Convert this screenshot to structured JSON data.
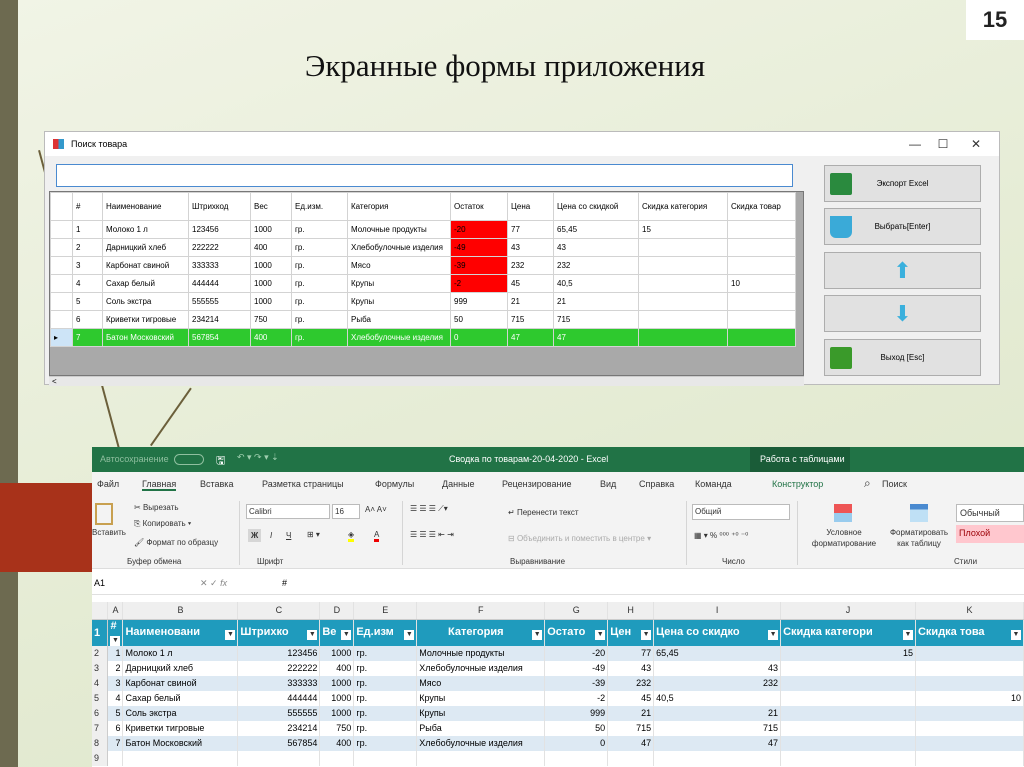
{
  "slide": {
    "number": "15",
    "title": "Экранные формы приложения"
  },
  "form": {
    "title": "Поиск товара",
    "search_value": "",
    "columns": [
      "#",
      "Наименование",
      "Штрихкод",
      "Вес",
      "Ед.изм.",
      "Категория",
      "Остаток",
      "Цена",
      "Цена со скидкой",
      "Скидка категория",
      "Скидка товар"
    ],
    "rows": [
      [
        "1",
        "Молоко 1 л",
        "123456",
        "1000",
        "гр.",
        "Молочные продукты",
        "-20",
        "77",
        "65,45",
        "15",
        ""
      ],
      [
        "2",
        "Дарницкий хлеб",
        "222222",
        "400",
        "гр.",
        "Хлебобулочные изделия",
        "-49",
        "43",
        "43",
        "",
        ""
      ],
      [
        "3",
        "Карбонат свиной",
        "333333",
        "1000",
        "гр.",
        "Мясо",
        "-39",
        "232",
        "232",
        "",
        ""
      ],
      [
        "4",
        "Сахар белый",
        "444444",
        "1000",
        "гр.",
        "Крупы",
        "-2",
        "45",
        "40,5",
        "",
        "10"
      ],
      [
        "5",
        "Соль экстра",
        "555555",
        "1000",
        "гр.",
        "Крупы",
        "999",
        "21",
        "21",
        "",
        ""
      ],
      [
        "6",
        "Криветки тигровые",
        "234214",
        "750",
        "гр.",
        "Рыба",
        "50",
        "715",
        "715",
        "",
        ""
      ],
      [
        "7",
        "Батон Московский",
        "567854",
        "400",
        "гр.",
        "Хлебобулочные изделия",
        "0",
        "47",
        "47",
        "",
        ""
      ]
    ],
    "selected_row": 7,
    "buttons": {
      "export": "Экспорт Excel",
      "select": "Выбрать[Enter]",
      "exit": "Выход [Esc]"
    }
  },
  "excel": {
    "autosave": "Автосохранение",
    "title": "Сводка по товарам-20-04-2020  -  Excel",
    "context_tab": "Работа с таблицами",
    "tabs": [
      "Файл",
      "Главная",
      "Вставка",
      "Разметка страницы",
      "Формулы",
      "Данные",
      "Рецензирование",
      "Вид",
      "Справка",
      "Команда",
      "Конструктор"
    ],
    "search": "Поиск",
    "ribbon": {
      "paste": "Вставить",
      "cut": "Вырезать",
      "copy": "Копировать",
      "format_painter": "Формат по образцу",
      "clipboard": "Буфер обмена",
      "font_name": "Calibri",
      "font_size": "16",
      "font": "Шрифт",
      "bold": "Ж",
      "italic": "I",
      "underline": "Ч",
      "wrap": "Перенести текст",
      "merge": "Объединить и поместить в центре",
      "alignment": "Выравнивание",
      "number_format": "Общий",
      "number": "Число",
      "cond_format": "Условное форматирование",
      "format_table": "Форматировать как таблицу",
      "styles": "Стили",
      "style_normal": "Обычный",
      "style_bad": "Плохой"
    },
    "name_box": "A1",
    "formula": "#",
    "col_letters": [
      "A",
      "B",
      "C",
      "D",
      "E",
      "F",
      "G",
      "H",
      "I",
      "J",
      "K"
    ],
    "headers": [
      "#",
      "Наименовани",
      "Штрихко",
      "Ве",
      "Ед.изм",
      "Категория",
      "Остато",
      "Цен",
      "Цена со скидко",
      "Скидка категори",
      "Скидка това"
    ],
    "rows": [
      [
        "1",
        "Молоко 1 л",
        "123456",
        "1000",
        "гр.",
        "Молочные продукты",
        "-20",
        "77",
        "65,45",
        "15",
        ""
      ],
      [
        "2",
        "Дарницкий хлеб",
        "222222",
        "400",
        "гр.",
        "Хлебобулочные изделия",
        "-49",
        "43",
        "43",
        "",
        ""
      ],
      [
        "3",
        "Карбонат свиной",
        "333333",
        "1000",
        "гр.",
        "Мясо",
        "-39",
        "232",
        "232",
        "",
        ""
      ],
      [
        "4",
        "Сахар белый",
        "444444",
        "1000",
        "гр.",
        "Крупы",
        "-2",
        "45",
        "40,5",
        "",
        "10"
      ],
      [
        "5",
        "Соль экстра",
        "555555",
        "1000",
        "гр.",
        "Крупы",
        "999",
        "21",
        "21",
        "",
        ""
      ],
      [
        "6",
        "Криветки тигровые",
        "234214",
        "750",
        "гр.",
        "Рыба",
        "50",
        "715",
        "715",
        "",
        ""
      ],
      [
        "7",
        "Батон Московский",
        "567854",
        "400",
        "гр.",
        "Хлебобулочные изделия",
        "0",
        "47",
        "47",
        "",
        ""
      ]
    ]
  },
  "colors": {
    "accent": "#217346",
    "table_header": "#1f9bbd",
    "negative": "#ff0000",
    "selected": "#2ec92e"
  }
}
